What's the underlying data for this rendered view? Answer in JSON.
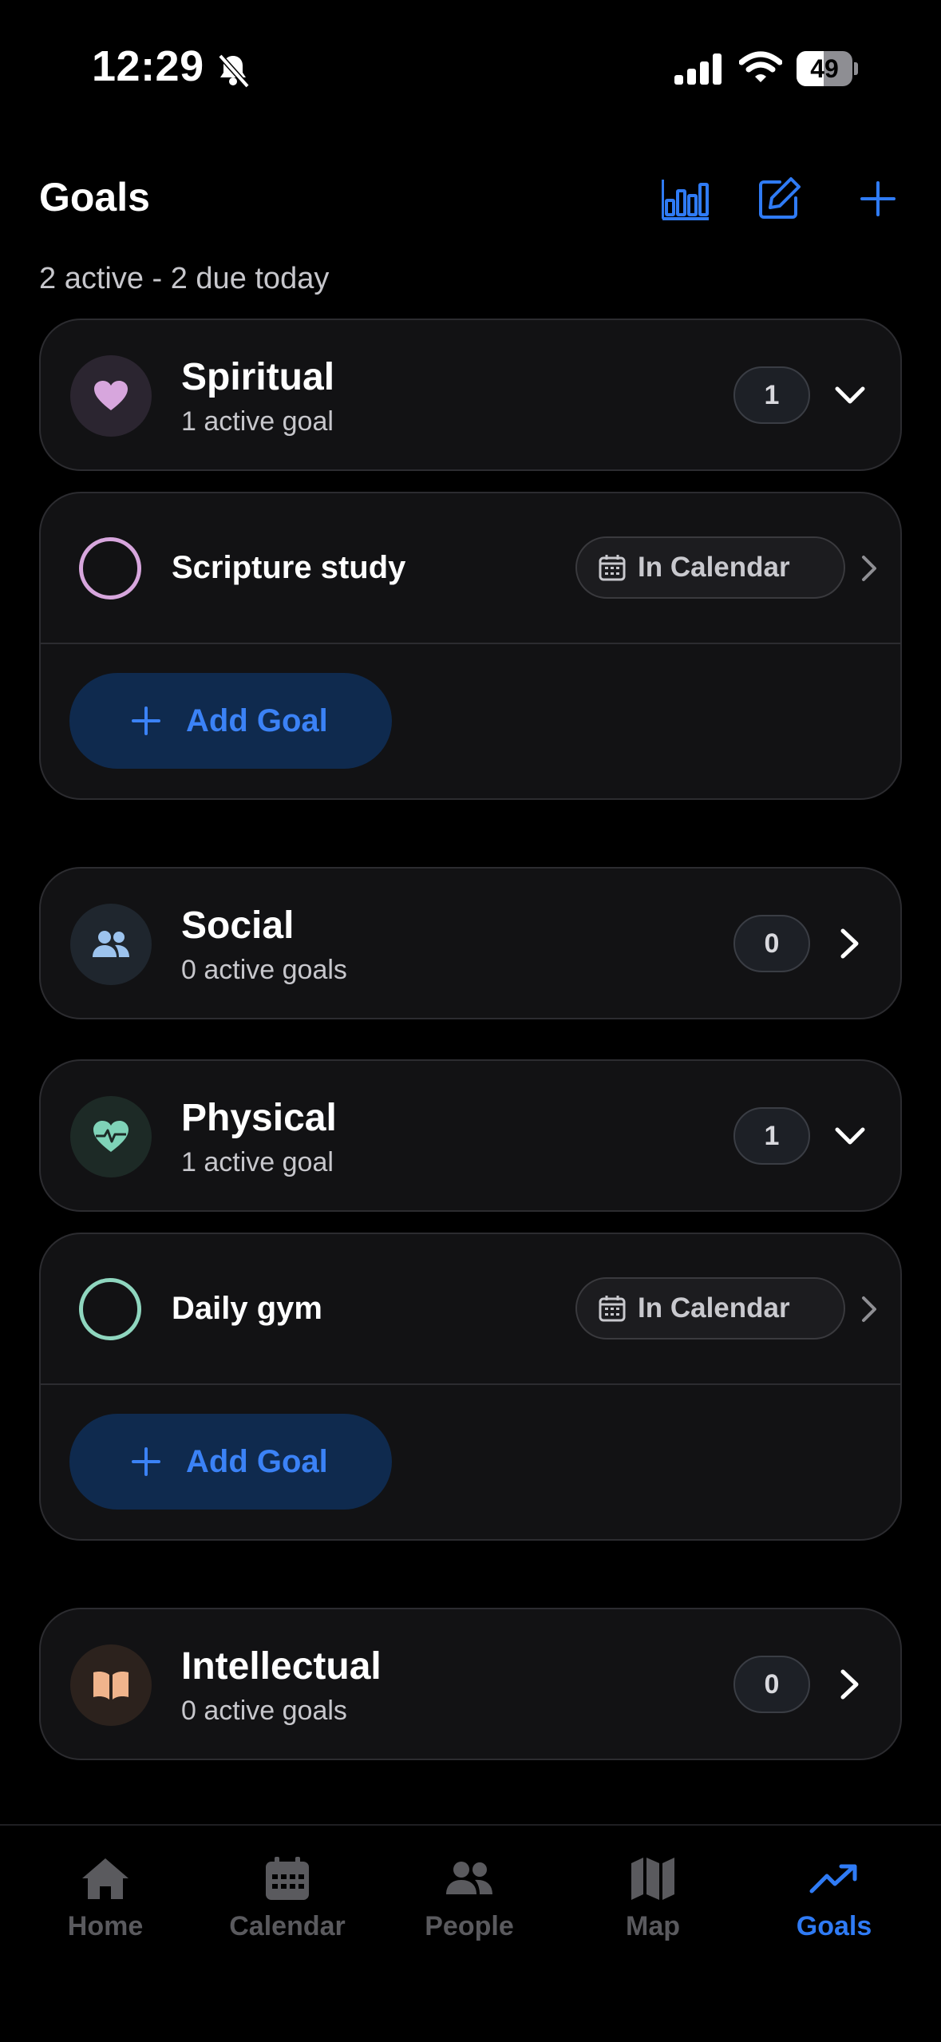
{
  "status_bar": {
    "time": "12:29",
    "battery": "49",
    "battery_level": 0.49
  },
  "header": {
    "title": "Goals",
    "subtitle": "2 active - 2 due today",
    "icons": [
      "chart-icon",
      "edit-icon",
      "plus-icon"
    ]
  },
  "categories": [
    {
      "name": "Spiritual",
      "sub": "1 active goal",
      "count": "1",
      "expanded": true,
      "icon": "heart-icon",
      "color": "#d7a6dd",
      "goals": [
        {
          "name": "Scripture study",
          "badge": "In Calendar",
          "color": "#d7a6dd"
        }
      ],
      "add_label": "Add Goal"
    },
    {
      "name": "Social",
      "sub": "0 active goals",
      "count": "0",
      "expanded": false,
      "icon": "people-icon",
      "color": "#9cc3ee"
    },
    {
      "name": "Physical",
      "sub": "1 active goal",
      "count": "1",
      "expanded": true,
      "icon": "heart-pulse-icon",
      "color": "#7fd3b8",
      "goals": [
        {
          "name": "Daily gym",
          "badge": "In Calendar",
          "color": "#8fd6bf"
        }
      ],
      "add_label": "Add Goal"
    },
    {
      "name": "Intellectual",
      "sub": "0 active goals",
      "count": "0",
      "expanded": false,
      "icon": "book-icon",
      "color": "#f0b48c"
    }
  ],
  "tabs": [
    {
      "label": "Home",
      "icon": "home-icon",
      "active": false
    },
    {
      "label": "Calendar",
      "icon": "calendar-icon",
      "active": false
    },
    {
      "label": "People",
      "icon": "people-icon",
      "active": false
    },
    {
      "label": "Map",
      "icon": "map-icon",
      "active": false
    },
    {
      "label": "Goals",
      "icon": "trending-up-icon",
      "active": true
    }
  ],
  "colors": {
    "accent": "#2f7bf5",
    "background": "#000000",
    "card": "#121214"
  }
}
